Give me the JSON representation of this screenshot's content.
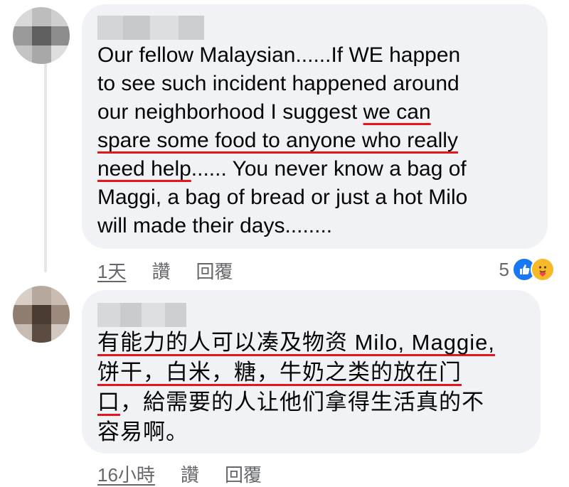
{
  "comments": [
    {
      "author_name_hidden": true,
      "lines": [
        {
          "segments": [
            {
              "text": "Our fellow Malaysian......If WE happen",
              "ul": false
            }
          ]
        },
        {
          "segments": [
            {
              "text": "to see such incident happened around",
              "ul": false
            }
          ]
        },
        {
          "segments": [
            {
              "text": "our neighborhood I suggest ",
              "ul": false
            },
            {
              "text": "we can",
              "ul": true
            }
          ]
        },
        {
          "segments": [
            {
              "text": "spare some food to anyone who really",
              "ul": true
            }
          ]
        },
        {
          "segments": [
            {
              "text": "need help",
              "ul": true
            },
            {
              "text": "...... You never know a bag of",
              "ul": false
            }
          ]
        },
        {
          "segments": [
            {
              "text": "Maggi, a bag of bread or just a hot Milo",
              "ul": false
            }
          ]
        },
        {
          "segments": [
            {
              "text": "will made their days........",
              "ul": false
            }
          ]
        }
      ],
      "time": "1天",
      "like_label": "讚",
      "reply_label": "回覆",
      "reaction_count": "5",
      "reaction_icons": [
        "like-icon",
        "care-icon"
      ],
      "colors": {
        "like": "#1877f2",
        "care": "#f7b928"
      }
    },
    {
      "author_name_hidden": true,
      "lines": [
        {
          "segments": [
            {
              "text": "有能力的人可以凑及物资 Milo, Maggie,",
              "ul": true
            }
          ]
        },
        {
          "segments": [
            {
              "text": "饼干，白米，糖，牛奶之类的放在门",
              "ul": true
            }
          ]
        },
        {
          "segments": [
            {
              "text": "口",
              "ul": true
            },
            {
              "text": "，給需要的人让他们拿得生活真的不",
              "ul": false
            }
          ]
        },
        {
          "segments": [
            {
              "text": "容易啊。",
              "ul": false
            }
          ]
        }
      ],
      "time": "16小時",
      "like_label": "讚",
      "reply_label": "回覆"
    }
  ],
  "colors": {
    "bubble": "#f0f2f5",
    "underline": "#e4161b",
    "meta_text": "#65676b"
  }
}
